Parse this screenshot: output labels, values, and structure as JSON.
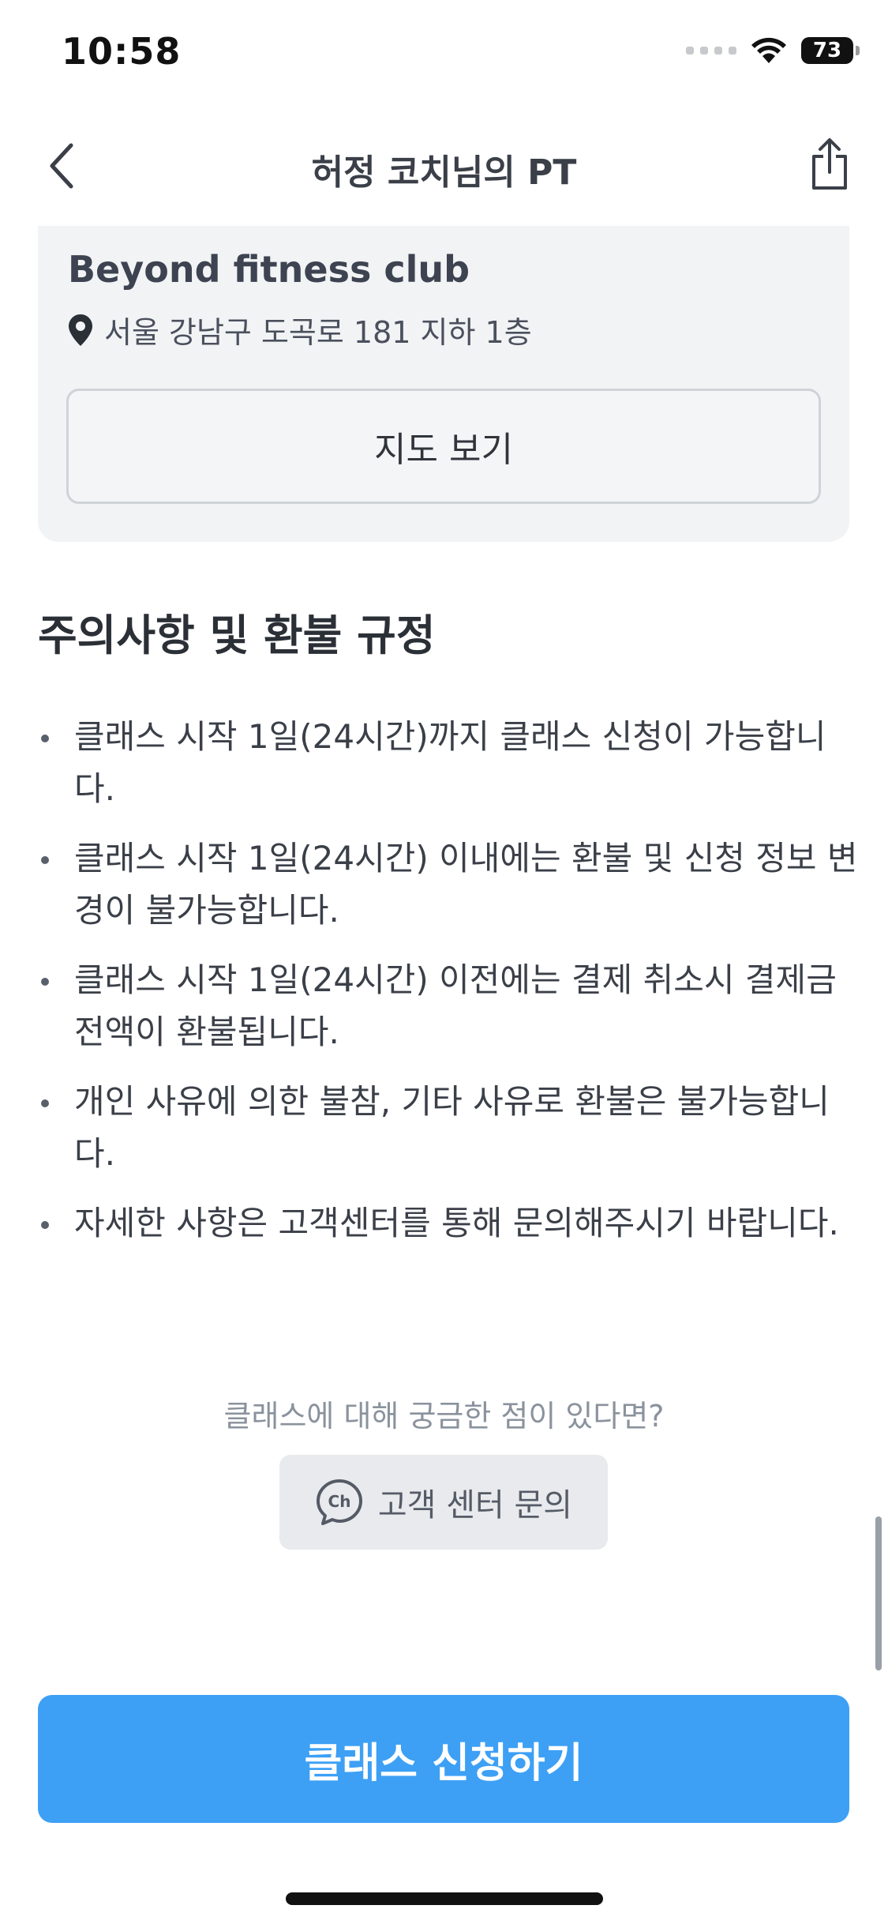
{
  "status_bar": {
    "time": "10:58",
    "battery": "73"
  },
  "nav": {
    "title": "허정 코치님의 PT",
    "back_icon": "chevron-left-icon",
    "share_icon": "share-icon"
  },
  "location": {
    "name": "Beyond fitness club",
    "address": "서울 강남구 도곡로 181 지하 1층",
    "address_icon": "map-pin-icon",
    "map_button": "지도 보기"
  },
  "notice": {
    "title": "주의사항 및 환불 규정",
    "items": [
      "클래스 시작 1일(24시간)까지 클래스 신청이 가능합니다.",
      "클래스 시작 1일(24시간) 이내에는 환불 및 신청 정보 변경이 불가능합니다.",
      "클래스 시작 1일(24시간) 이전에는 결제 취소시 결제금 전액이 환불됩니다.",
      "개인 사유에 의한 불참, 기타 사유로 환불은 불가능합니다.",
      "자세한 사항은 고객센터를 통해 문의해주시기 바랍니다."
    ]
  },
  "help": {
    "question": "클래스에 대해 궁금한 점이 있다면?",
    "support_button": "고객 센터 문의",
    "support_icon": "channel-chat-icon",
    "support_icon_text": "Ch"
  },
  "cta": {
    "label": "클래스 신청하기"
  },
  "colors": {
    "primary": "#3da0f5",
    "card_bg": "#f1f3f5",
    "support_bg": "#e8eaed"
  }
}
